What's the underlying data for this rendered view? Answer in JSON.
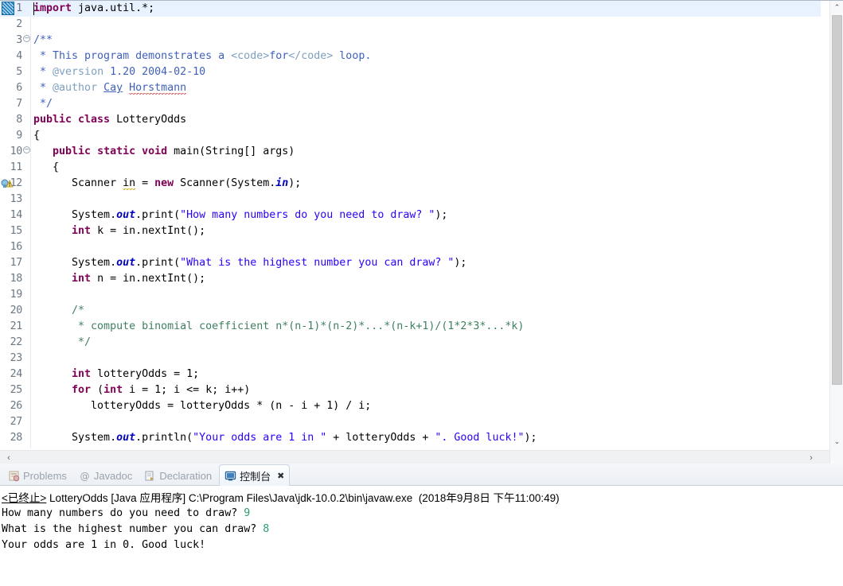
{
  "editor": {
    "file_title": "LotteryOdds.java",
    "cursor_line": 1,
    "font_size_px": 13.3,
    "colors": {
      "keyword": "#7f0055",
      "string": "#2a00ff",
      "javadoc": "#3f5fbf",
      "javadoc_tag": "#7f9fbf",
      "static_field": "#0000c0",
      "line_number": "#6b7785",
      "current_line_bg": "#e8f2fe",
      "spell_error": "#e04a4a",
      "warning": "#d6a400"
    },
    "lines": [
      {
        "n": "1",
        "fold": false,
        "marker": "cursor-line",
        "current": true,
        "tokens": [
          {
            "t": "import ",
            "c": "kw"
          },
          {
            "t": "java.util.*;",
            "c": "plain"
          }
        ]
      },
      {
        "n": "2",
        "fold": false,
        "marker": "",
        "current": false,
        "tokens": []
      },
      {
        "n": "3",
        "fold": true,
        "marker": "",
        "current": false,
        "tokens": [
          {
            "t": "/**",
            "c": "jdoc"
          }
        ]
      },
      {
        "n": "4",
        "fold": false,
        "marker": "",
        "current": false,
        "tokens": [
          {
            "t": " * This program demonstrates a ",
            "c": "jdoc"
          },
          {
            "t": "<code>",
            "c": "jtag"
          },
          {
            "t": "for",
            "c": "jdoc"
          },
          {
            "t": "</code>",
            "c": "jtag"
          },
          {
            "t": " loop.",
            "c": "jdoc"
          }
        ]
      },
      {
        "n": "5",
        "fold": false,
        "marker": "",
        "current": false,
        "tokens": [
          {
            "t": " * ",
            "c": "jdoc"
          },
          {
            "t": "@version",
            "c": "jtag"
          },
          {
            "t": " 1.20 2004-02-10",
            "c": "jdoc"
          }
        ]
      },
      {
        "n": "6",
        "fold": false,
        "marker": "",
        "current": false,
        "tokens": [
          {
            "t": " * ",
            "c": "jdoc"
          },
          {
            "t": "@author",
            "c": "jtag"
          },
          {
            "t": " ",
            "c": "jdoc"
          },
          {
            "t": "Cay",
            "c": "jdoc link-under"
          },
          {
            "t": " ",
            "c": "jdoc"
          },
          {
            "t": "Horstmann",
            "c": "jdoc sq-under"
          }
        ]
      },
      {
        "n": "7",
        "fold": false,
        "marker": "",
        "current": false,
        "tokens": [
          {
            "t": " */",
            "c": "jdoc"
          }
        ]
      },
      {
        "n": "8",
        "fold": false,
        "marker": "",
        "current": false,
        "tokens": [
          {
            "t": "public class ",
            "c": "kw"
          },
          {
            "t": "LotteryOdds",
            "c": "plain"
          }
        ]
      },
      {
        "n": "9",
        "fold": false,
        "marker": "",
        "current": false,
        "tokens": [
          {
            "t": "{",
            "c": "plain"
          }
        ]
      },
      {
        "n": "10",
        "fold": true,
        "marker": "",
        "current": false,
        "tokens": [
          {
            "t": "   ",
            "c": "plain"
          },
          {
            "t": "public static void ",
            "c": "kw"
          },
          {
            "t": "main(String[] args)",
            "c": "plain"
          }
        ]
      },
      {
        "n": "11",
        "fold": false,
        "marker": "",
        "current": false,
        "tokens": [
          {
            "t": "   {",
            "c": "plain"
          }
        ]
      },
      {
        "n": "12",
        "fold": false,
        "marker": "warning",
        "current": false,
        "tokens": [
          {
            "t": "      Scanner ",
            "c": "plain"
          },
          {
            "t": "in",
            "c": "plain sq-under-amber"
          },
          {
            "t": " = ",
            "c": "plain"
          },
          {
            "t": "new ",
            "c": "kw"
          },
          {
            "t": "Scanner(System.",
            "c": "plain"
          },
          {
            "t": "in",
            "c": "fld"
          },
          {
            "t": ");",
            "c": "plain"
          }
        ]
      },
      {
        "n": "13",
        "fold": false,
        "marker": "",
        "current": false,
        "tokens": []
      },
      {
        "n": "14",
        "fold": false,
        "marker": "",
        "current": false,
        "tokens": [
          {
            "t": "      System.",
            "c": "plain"
          },
          {
            "t": "out",
            "c": "fld"
          },
          {
            "t": ".print(",
            "c": "plain"
          },
          {
            "t": "\"How many numbers do you need to draw? \"",
            "c": "str"
          },
          {
            "t": ");",
            "c": "plain"
          }
        ]
      },
      {
        "n": "15",
        "fold": false,
        "marker": "",
        "current": false,
        "tokens": [
          {
            "t": "      ",
            "c": "plain"
          },
          {
            "t": "int ",
            "c": "kw"
          },
          {
            "t": "k = in.nextInt();",
            "c": "plain"
          }
        ]
      },
      {
        "n": "16",
        "fold": false,
        "marker": "",
        "current": false,
        "tokens": []
      },
      {
        "n": "17",
        "fold": false,
        "marker": "",
        "current": false,
        "tokens": [
          {
            "t": "      System.",
            "c": "plain"
          },
          {
            "t": "out",
            "c": "fld"
          },
          {
            "t": ".print(",
            "c": "plain"
          },
          {
            "t": "\"What is the highest number you can draw? \"",
            "c": "str"
          },
          {
            "t": ");",
            "c": "plain"
          }
        ]
      },
      {
        "n": "18",
        "fold": false,
        "marker": "",
        "current": false,
        "tokens": [
          {
            "t": "      ",
            "c": "plain"
          },
          {
            "t": "int ",
            "c": "kw"
          },
          {
            "t": "n = in.nextInt();",
            "c": "plain"
          }
        ]
      },
      {
        "n": "19",
        "fold": false,
        "marker": "",
        "current": false,
        "tokens": []
      },
      {
        "n": "20",
        "fold": false,
        "marker": "",
        "current": false,
        "tokens": [
          {
            "t": "      /*",
            "c": "cmt"
          }
        ]
      },
      {
        "n": "21",
        "fold": false,
        "marker": "",
        "current": false,
        "tokens": [
          {
            "t": "       * compute binomial coefficient n*(n-1)*(n-2)*...*(n-k+1)/(1*2*3*...*k)",
            "c": "cmt"
          }
        ]
      },
      {
        "n": "22",
        "fold": false,
        "marker": "",
        "current": false,
        "tokens": [
          {
            "t": "       */",
            "c": "cmt"
          }
        ]
      },
      {
        "n": "23",
        "fold": false,
        "marker": "",
        "current": false,
        "tokens": []
      },
      {
        "n": "24",
        "fold": false,
        "marker": "",
        "current": false,
        "tokens": [
          {
            "t": "      ",
            "c": "plain"
          },
          {
            "t": "int ",
            "c": "kw"
          },
          {
            "t": "lotteryOdds = 1;",
            "c": "plain"
          }
        ]
      },
      {
        "n": "25",
        "fold": false,
        "marker": "",
        "current": false,
        "tokens": [
          {
            "t": "      ",
            "c": "plain"
          },
          {
            "t": "for ",
            "c": "kw"
          },
          {
            "t": "(",
            "c": "plain"
          },
          {
            "t": "int ",
            "c": "kw"
          },
          {
            "t": "i = 1; i <= k; i++)",
            "c": "plain"
          }
        ]
      },
      {
        "n": "26",
        "fold": false,
        "marker": "",
        "current": false,
        "tokens": [
          {
            "t": "         lotteryOdds = lotteryOdds * (n - i + 1) / i;",
            "c": "plain"
          }
        ]
      },
      {
        "n": "27",
        "fold": false,
        "marker": "",
        "current": false,
        "tokens": []
      },
      {
        "n": "28",
        "fold": false,
        "marker": "",
        "current": false,
        "tokens": [
          {
            "t": "      System.",
            "c": "plain"
          },
          {
            "t": "out",
            "c": "fld"
          },
          {
            "t": ".println(",
            "c": "plain"
          },
          {
            "t": "\"Your odds are 1 in \"",
            "c": "str"
          },
          {
            "t": " + lotteryOdds + ",
            "c": "plain"
          },
          {
            "t": "\". Good luck!\"",
            "c": "str"
          },
          {
            "t": ");",
            "c": "plain"
          }
        ]
      }
    ]
  },
  "scrollbars": {
    "vertical_up_glyph": "⌃",
    "vertical_down_glyph": "⌄",
    "horizontal_left_glyph": "‹",
    "horizontal_right_glyph": "›"
  },
  "bottom_panel": {
    "tabs": [
      {
        "label": "Problems",
        "icon": "problems-icon",
        "active": false,
        "closable": false
      },
      {
        "label": "Javadoc",
        "icon": "javadoc-icon",
        "active": false,
        "closable": false
      },
      {
        "label": "Declaration",
        "icon": "declaration-icon",
        "active": false,
        "closable": false
      },
      {
        "label": "控制台",
        "icon": "console-icon",
        "active": true,
        "closable": true
      }
    ],
    "close_glyph": "✖",
    "console": {
      "status": "<已终止>",
      "launch_name": "LotteryOdds",
      "launch_type": "[Java 应用程序]",
      "jvm_path": "C:\\Program Files\\Java\\jdk-10.0.2\\bin\\javaw.exe",
      "timestamp": "(2018年9月8日 下午11:00:49)",
      "output_lines": [
        {
          "prompt": "How many numbers do you need to draw? ",
          "input": "9"
        },
        {
          "prompt": "What is the highest number you can draw? ",
          "input": "8"
        },
        {
          "prompt": "Your odds are 1 in 0. Good luck!",
          "input": ""
        }
      ]
    }
  }
}
